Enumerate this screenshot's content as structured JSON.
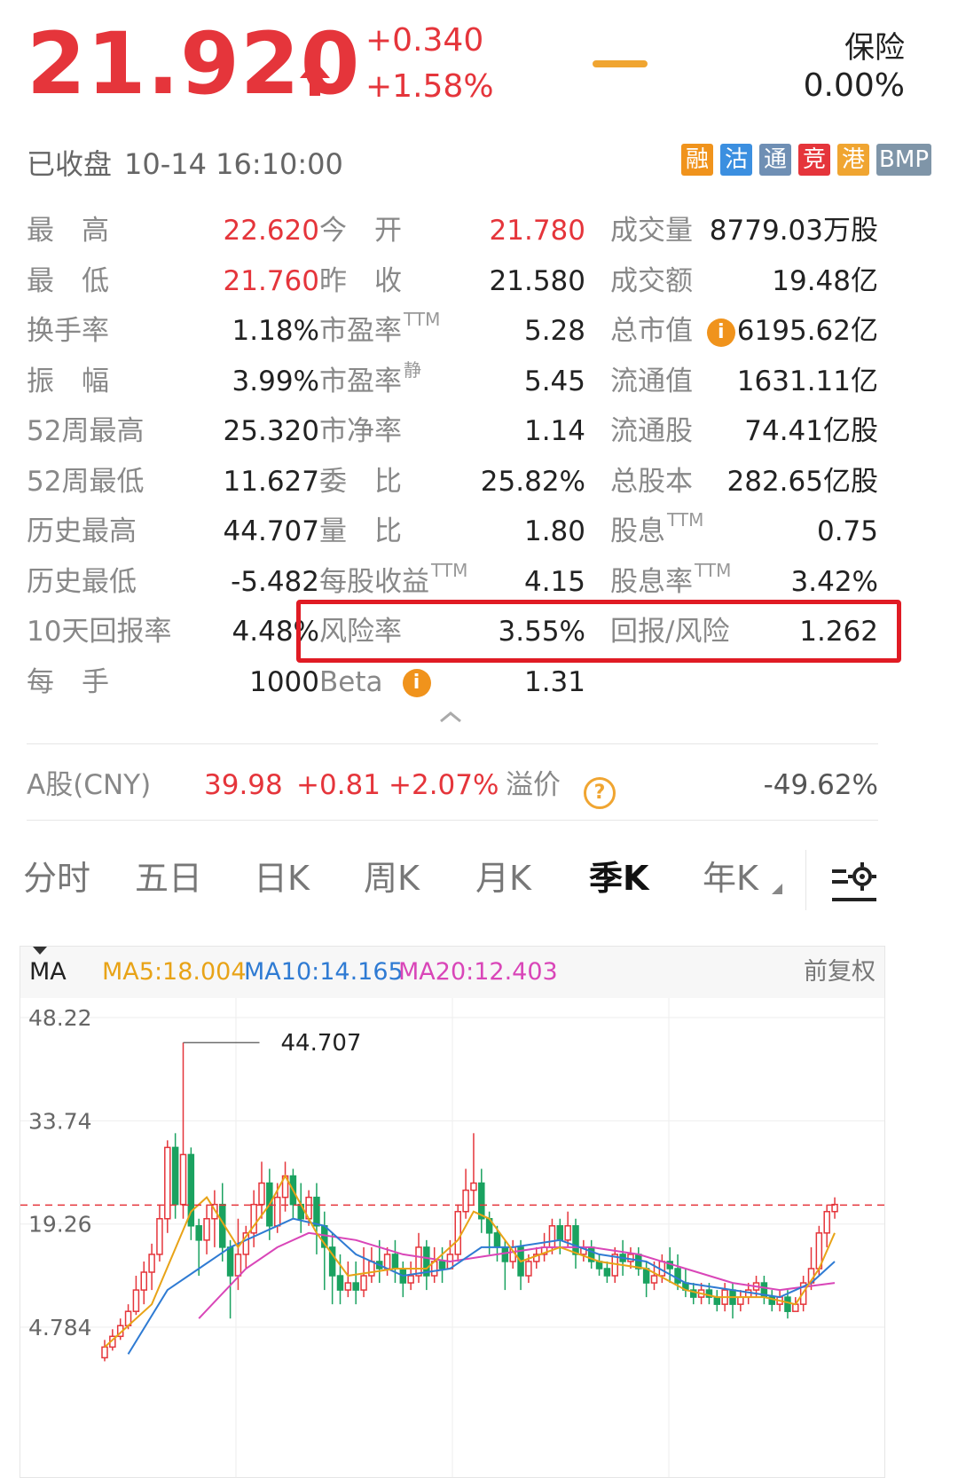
{
  "quote": {
    "price": "21.920",
    "change": "+0.340",
    "change_pct": "+1.58%",
    "insurance_label": "保险",
    "insurance_value": "0.00%"
  },
  "status": {
    "state": "已收盘",
    "time": "10-14 16:10:00"
  },
  "badges": [
    {
      "label": "融",
      "color": "#f0931c"
    },
    {
      "label": "沽",
      "color": "#3b8fe0"
    },
    {
      "label": "通",
      "color": "#6f8fb4"
    },
    {
      "label": "竞",
      "color": "#e5353b"
    },
    {
      "label": "港",
      "color": "#f0a531"
    },
    {
      "label": "BMP",
      "color": "#7f95a8"
    }
  ],
  "stats": [
    [
      {
        "label": "最　高",
        "value": "22.620",
        "red": true
      },
      {
        "label": "今　开",
        "value": "21.780",
        "red": true
      },
      {
        "label": "成交量",
        "value": "8779.03万股"
      }
    ],
    [
      {
        "label": "最　低",
        "value": "21.760",
        "red": true
      },
      {
        "label": "昨　收",
        "value": "21.580"
      },
      {
        "label": "成交额",
        "value": "19.48亿"
      }
    ],
    [
      {
        "label": "换手率",
        "value": "1.18%"
      },
      {
        "label": "市盈率",
        "sup": "TTM",
        "value": "5.28"
      },
      {
        "label": "总市值",
        "value": "6195.62亿",
        "info": true
      }
    ],
    [
      {
        "label": "振　幅",
        "value": "3.99%"
      },
      {
        "label": "市盈率",
        "sup": "静",
        "value": "5.45"
      },
      {
        "label": "流通值",
        "value": "1631.11亿"
      }
    ],
    [
      {
        "label": "52周最高",
        "value": "25.320"
      },
      {
        "label": "市净率",
        "value": "1.14"
      },
      {
        "label": "流通股",
        "value": "74.41亿股"
      }
    ],
    [
      {
        "label": "52周最低",
        "value": "11.627"
      },
      {
        "label": "委　比",
        "value": "25.82%"
      },
      {
        "label": "总股本",
        "value": "282.65亿股"
      }
    ],
    [
      {
        "label": "历史最高",
        "value": "44.707"
      },
      {
        "label": "量　比",
        "value": "1.80"
      },
      {
        "label": "股息",
        "sup": "TTM",
        "value": "0.75"
      }
    ],
    [
      {
        "label": "历史最低",
        "value": "-5.482"
      },
      {
        "label": "每股收益",
        "sup": "TTM",
        "value": "4.15"
      },
      {
        "label": "股息率",
        "sup": "TTM",
        "value": "3.42%"
      }
    ],
    [
      {
        "label": "10天回报率",
        "value": "4.48%"
      },
      {
        "label": "风险率",
        "value": "3.55%"
      },
      {
        "label": "回报/风险",
        "value": "1.262"
      }
    ],
    [
      {
        "label": "每　手",
        "value": "1000"
      },
      {
        "label": "Beta",
        "value": "1.31",
        "info": true
      },
      null
    ]
  ],
  "a_share": {
    "label": "A股(CNY)",
    "price": "39.98",
    "change": "+0.81",
    "change_pct": "+2.07%",
    "premium_label": "溢价",
    "premium_value": "-49.62%"
  },
  "tabs": [
    "分时",
    "五日",
    "日K",
    "周K",
    "月K",
    "季K",
    "年K"
  ],
  "active_tab": "季K",
  "ma": {
    "selector": "MA",
    "ma5": "MA5:18.004",
    "ma10": "MA10:14.165",
    "ma20": "MA20:12.403",
    "adjust": "前复权",
    "colors": {
      "ma5": "#e8a317",
      "ma10": "#2f7bd3",
      "ma20": "#d946b8"
    }
  },
  "chart_data": {
    "type": "candlestick",
    "y_ticks": [
      "48.22",
      "33.74",
      "19.26",
      "4.784"
    ],
    "y_tick_values": [
      48.22,
      33.74,
      19.26,
      4.784
    ],
    "max_label": "44.707",
    "max_value": 44.707,
    "last_price": 21.92,
    "up_color": "#e5353b",
    "down_color": "#1aa260",
    "candles": [
      [
        0.5,
        2,
        0,
        3
      ],
      [
        2,
        3.5,
        1.5,
        4.5
      ],
      [
        3.5,
        5,
        3,
        6
      ],
      [
        5,
        7,
        4.5,
        8
      ],
      [
        7,
        10,
        6.5,
        12
      ],
      [
        10,
        12.5,
        8,
        14
      ],
      [
        12.5,
        15,
        10,
        16.5
      ],
      [
        15,
        20,
        14,
        22
      ],
      [
        20,
        30,
        18,
        31
      ],
      [
        30,
        22,
        20,
        32
      ],
      [
        22,
        29,
        20,
        44.7
      ],
      [
        29,
        19,
        17,
        30
      ],
      [
        19,
        17,
        12,
        20
      ],
      [
        17,
        20,
        15,
        22
      ],
      [
        20,
        22,
        16,
        24
      ],
      [
        22,
        16,
        14,
        25
      ],
      [
        16,
        12,
        6,
        17
      ],
      [
        12,
        15,
        10,
        20
      ],
      [
        15,
        18,
        13,
        19
      ],
      [
        18,
        22,
        16,
        24
      ],
      [
        22,
        25,
        20,
        28
      ],
      [
        25,
        19,
        17,
        27
      ],
      [
        19,
        23,
        18,
        25
      ],
      [
        23,
        26,
        21,
        28
      ],
      [
        26,
        22,
        20,
        27
      ],
      [
        22,
        20,
        18,
        25
      ],
      [
        20,
        23,
        19,
        24
      ],
      [
        23,
        19,
        15,
        25
      ],
      [
        19,
        16,
        10,
        21
      ],
      [
        16,
        12,
        8,
        18
      ],
      [
        12,
        10,
        8,
        15
      ],
      [
        10,
        11,
        9,
        14
      ],
      [
        11,
        10,
        8,
        14
      ],
      [
        10,
        12,
        9,
        16
      ],
      [
        12,
        14,
        11,
        16
      ],
      [
        14,
        13,
        11,
        17
      ],
      [
        13,
        15,
        12,
        16
      ],
      [
        15,
        13,
        11,
        17
      ],
      [
        13,
        11,
        9,
        14
      ],
      [
        11,
        12,
        10,
        14
      ],
      [
        12,
        16,
        11,
        18
      ],
      [
        16,
        12,
        10,
        17
      ],
      [
        12,
        14,
        11,
        16
      ],
      [
        14,
        13,
        11,
        16
      ],
      [
        13,
        15,
        13,
        17
      ],
      [
        15,
        21,
        14,
        22
      ],
      [
        21,
        24,
        20,
        27
      ],
      [
        24,
        25,
        22,
        32
      ],
      [
        25,
        20,
        18,
        27
      ],
      [
        20,
        18,
        15,
        21
      ],
      [
        18,
        16,
        14,
        19
      ],
      [
        16,
        14,
        10,
        17
      ],
      [
        14,
        16,
        13,
        17
      ],
      [
        16,
        12,
        10,
        17
      ],
      [
        12,
        14,
        11,
        15
      ],
      [
        14,
        15,
        13,
        16
      ],
      [
        15,
        16,
        14,
        18
      ],
      [
        16,
        19,
        15,
        20
      ],
      [
        19,
        17,
        15,
        20
      ],
      [
        17,
        19,
        16,
        21
      ],
      [
        19,
        15,
        13,
        20
      ],
      [
        15,
        16,
        14,
        17
      ],
      [
        16,
        14,
        13,
        17
      ],
      [
        14,
        13,
        12,
        15
      ],
      [
        13,
        12,
        11,
        14
      ],
      [
        12,
        15,
        11,
        16
      ],
      [
        15,
        14,
        12,
        17
      ],
      [
        14,
        15,
        13,
        16
      ],
      [
        15,
        13,
        12,
        16
      ],
      [
        13,
        11,
        9,
        14
      ],
      [
        11,
        12,
        10,
        14
      ],
      [
        12,
        14,
        11,
        15
      ],
      [
        14,
        13,
        11,
        16
      ],
      [
        13,
        11,
        10,
        15
      ],
      [
        11,
        10,
        9,
        13
      ],
      [
        10,
        9,
        8,
        11
      ],
      [
        9,
        10,
        8,
        11
      ],
      [
        10,
        9,
        8,
        11
      ],
      [
        9,
        8,
        7,
        10
      ],
      [
        8,
        10,
        7,
        11
      ],
      [
        10,
        8,
        6,
        11
      ],
      [
        8,
        9,
        7,
        10
      ],
      [
        9,
        10,
        8,
        11
      ],
      [
        10,
        11,
        9,
        12
      ],
      [
        11,
        9,
        8,
        12
      ],
      [
        9,
        8,
        7,
        10
      ],
      [
        8,
        9,
        7,
        10
      ],
      [
        9,
        7,
        6,
        10
      ],
      [
        7,
        8,
        7,
        9
      ],
      [
        8,
        11,
        7,
        12
      ],
      [
        11,
        13,
        10,
        16
      ],
      [
        13,
        18,
        12,
        19
      ],
      [
        18,
        21,
        16,
        22
      ],
      [
        21,
        22,
        20,
        23
      ]
    ],
    "ma5_points": [
      [
        0,
        2
      ],
      [
        6,
        8
      ],
      [
        11,
        21
      ],
      [
        13,
        23
      ],
      [
        17,
        16
      ],
      [
        21,
        22
      ],
      [
        23,
        26
      ],
      [
        27,
        18
      ],
      [
        31,
        12
      ],
      [
        37,
        13
      ],
      [
        41,
        13
      ],
      [
        45,
        17
      ],
      [
        47,
        21
      ],
      [
        49,
        20
      ],
      [
        53,
        14
      ],
      [
        58,
        16
      ],
      [
        63,
        14
      ],
      [
        69,
        13
      ],
      [
        74,
        10
      ],
      [
        78,
        9
      ],
      [
        84,
        9
      ],
      [
        88,
        8
      ],
      [
        91,
        13
      ],
      [
        93,
        18
      ]
    ],
    "ma10_points": [
      [
        3,
        1
      ],
      [
        8,
        10
      ],
      [
        12,
        13
      ],
      [
        16,
        16
      ],
      [
        20,
        18
      ],
      [
        24,
        20
      ],
      [
        28,
        19
      ],
      [
        32,
        15
      ],
      [
        38,
        12
      ],
      [
        44,
        13
      ],
      [
        48,
        16
      ],
      [
        52,
        16
      ],
      [
        58,
        17
      ],
      [
        63,
        15
      ],
      [
        69,
        14
      ],
      [
        74,
        11
      ],
      [
        80,
        10
      ],
      [
        86,
        9
      ],
      [
        90,
        11
      ],
      [
        93,
        14
      ]
    ],
    "ma20_points": [
      [
        12,
        6
      ],
      [
        18,
        13
      ],
      [
        22,
        16
      ],
      [
        26,
        18
      ],
      [
        32,
        17
      ],
      [
        38,
        15
      ],
      [
        44,
        14
      ],
      [
        50,
        15
      ],
      [
        56,
        16
      ],
      [
        62,
        16
      ],
      [
        68,
        15
      ],
      [
        74,
        13
      ],
      [
        80,
        11
      ],
      [
        86,
        10
      ],
      [
        93,
        11
      ]
    ]
  }
}
